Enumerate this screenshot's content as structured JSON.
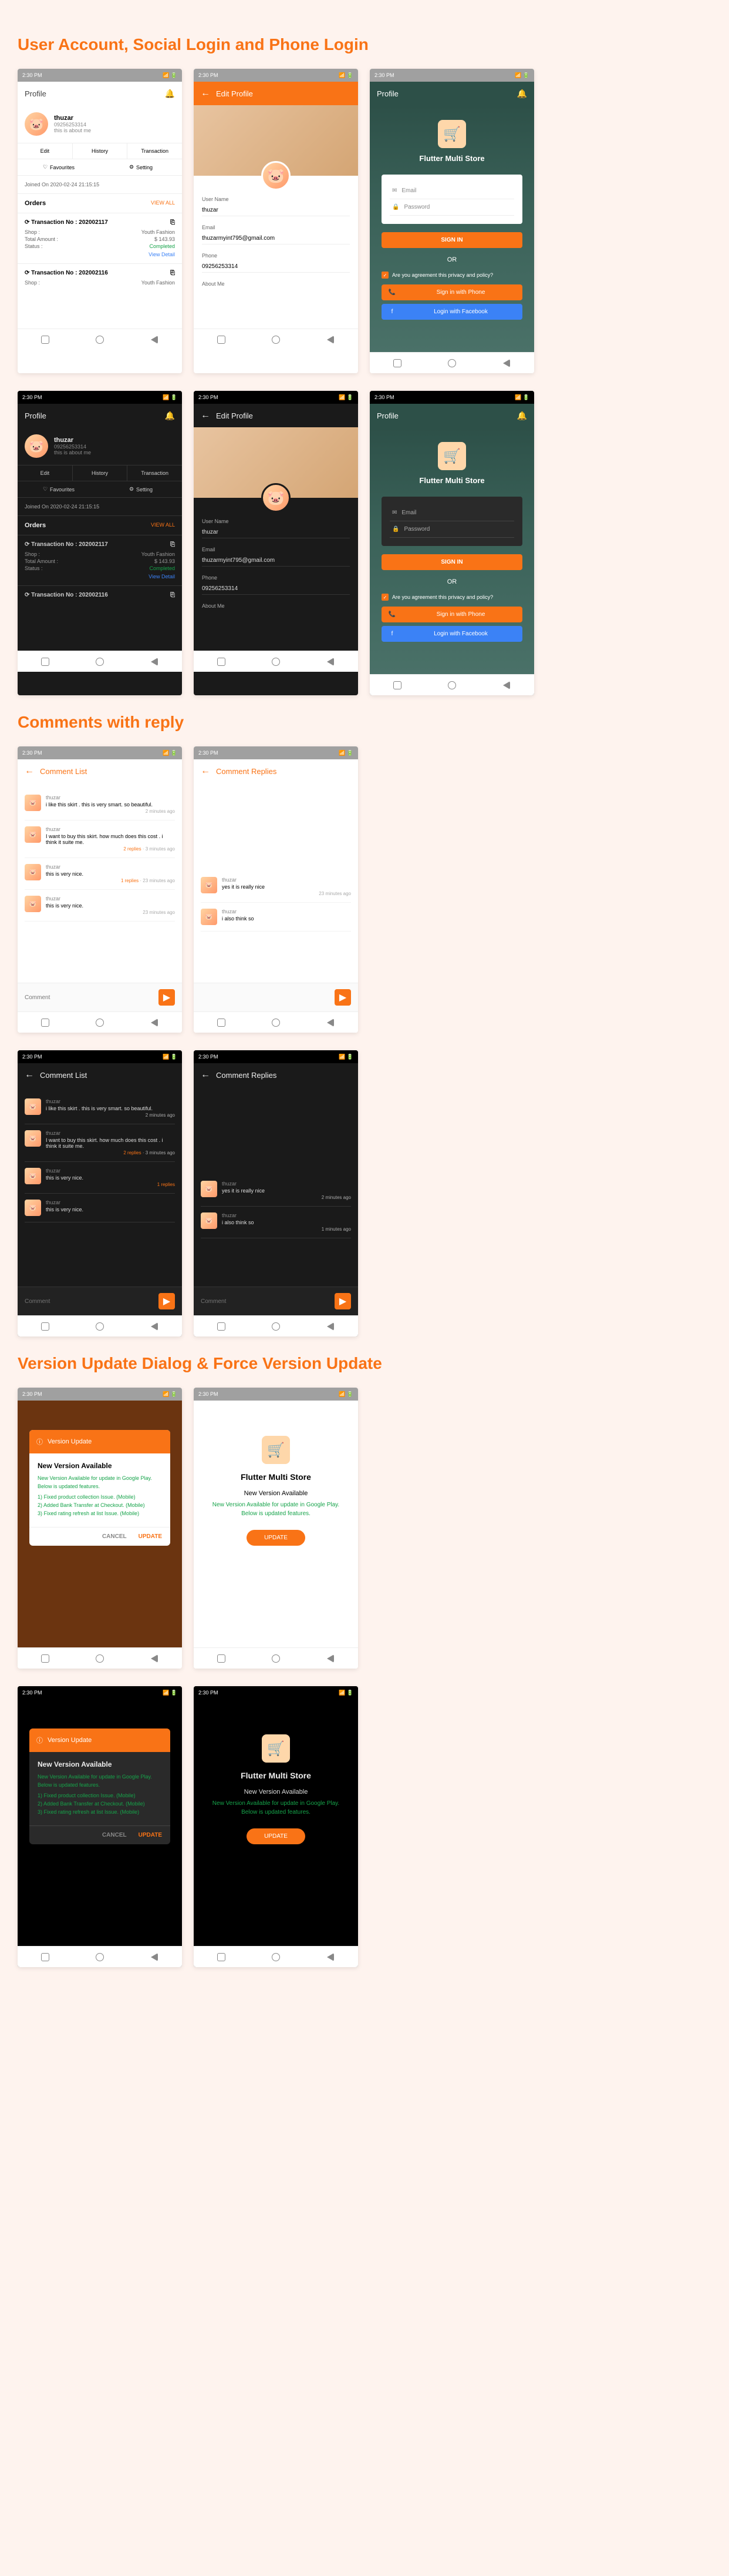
{
  "headings": {
    "h1": "User Account, Social Login and Phone Login",
    "h2": "Comments with reply",
    "h3": "Version Update Dialog & Force Version Update"
  },
  "status": {
    "time": "2:30 PM"
  },
  "profile": {
    "title": "Profile",
    "name": "thuzar",
    "phone_num": "09256253314",
    "bio": "this is about me",
    "tabs": {
      "edit": "Edit",
      "history": "History",
      "transaction": "Transaction"
    },
    "tabs2": {
      "fav": "Favourites",
      "setting": "Setting"
    },
    "joined": "Joined On 2020-02-24 21:15:15",
    "orders": "Orders",
    "viewall": "VIEW ALL",
    "trans1": {
      "no": "Transaction No : 202002117",
      "shop_l": "Shop :",
      "shop_v": "Youth Fashion",
      "amt_l": "Total Amount :",
      "amt_v": "$ 143.93",
      "status_l": "Status :",
      "status_v": "Completed",
      "detail": "View Detail"
    },
    "trans2": {
      "no": "Transaction No : 202002116",
      "shop_l": "Shop :",
      "shop_v": "Youth Fashion"
    }
  },
  "edit": {
    "title": "Edit Profile",
    "username_l": "User Name",
    "username_v": "thuzar",
    "email_l": "Email",
    "email_v": "thuzarmyint795@gmail.com",
    "phone_l": "Phone",
    "phone_v": "09256253314",
    "about_l": "About Me"
  },
  "login": {
    "title": "Profile",
    "brand": "Flutter Multi Store",
    "email": "Email",
    "password": "Password",
    "signin": "SIGN IN",
    "or": "OR",
    "agree": "Are you agreement this privacy and policy?",
    "phone_btn": "Sign in with Phone",
    "fb_btn": "Login with Facebook"
  },
  "comments": {
    "list_title": "Comment List",
    "replies_title": "Comment Replies",
    "user": "thuzar",
    "c1": "i like this skirt . this is very smart. so beautiful.",
    "c2": "I want to buy this skirt. how much does this cost . i think it suite me.",
    "c3": "this is very nice.",
    "c4": "this is very nice.",
    "r1": "yes it is really nice",
    "r2": "i also think so",
    "time1": "2 minutes ago",
    "time2": "3 minutes ago",
    "time3": "23 minutes ago",
    "replies2": "2 replies",
    "replies1": "1 replies",
    "placeholder": "Comment"
  },
  "dialog": {
    "head": "Version Update",
    "title": "New Version Available",
    "text": "New Version Available for update in Google Play. Below is updated features.",
    "i1": "1) Fixed product collection Issue. (Mobile)",
    "i2": "2) Added Bank Transfer at Checkout. (Mobile)",
    "i3": "3) Fixed rating refresh at list Issue. (Mobile)",
    "cancel": "CANCEL",
    "update": "UPDATE"
  },
  "force": {
    "brand": "Flutter Multi Store",
    "title": "New Version Available",
    "text": "New Version Available for update in Google Play. Below is updated features.",
    "btn": "UPDATE"
  }
}
